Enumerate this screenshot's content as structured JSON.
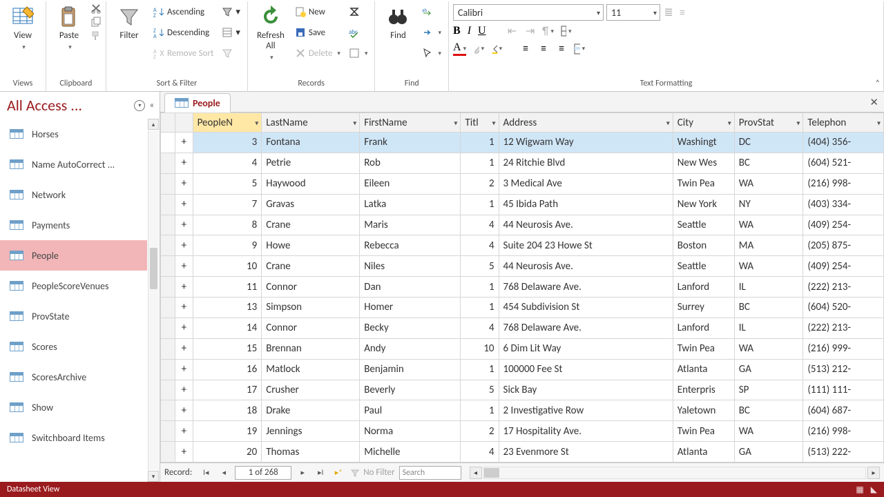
{
  "ribbon": {
    "groups": {
      "views": {
        "label": "Views",
        "view": "View"
      },
      "clipboard": {
        "label": "Clipboard",
        "paste": "Paste"
      },
      "sortfilter": {
        "label": "Sort & Filter",
        "filter": "Filter",
        "asc": "Ascending",
        "desc": "Descending",
        "remove": "Remove Sort"
      },
      "records": {
        "label": "Records",
        "refresh": "Refresh All",
        "new": "New",
        "save": "Save",
        "delete": "Delete"
      },
      "find": {
        "label": "Find",
        "find": "Find"
      },
      "textfmt": {
        "label": "Text Formatting",
        "font": "Calibri",
        "size": "11"
      }
    }
  },
  "nav": {
    "title": "All Access ...",
    "items": [
      "Horses",
      "Name AutoCorrect ...",
      "Network",
      "Payments",
      "People",
      "PeopleScoreVenues",
      "ProvState",
      "Scores",
      "ScoresArchive",
      "Show",
      "Switchboard Items"
    ],
    "selected": 4
  },
  "tab": {
    "title": "People"
  },
  "columns": [
    "PeopleN",
    "LastName",
    "FirstName",
    "Titl",
    "Address",
    "City",
    "ProvStat",
    "Telephon"
  ],
  "rows": [
    {
      "id": "3",
      "last": "Fontana",
      "first": "Frank",
      "title": "1",
      "addr": "12 Wigwam Way",
      "city": "Washingt",
      "prov": "DC",
      "tel": "(404) 356-"
    },
    {
      "id": "4",
      "last": "Petrie",
      "first": "Rob",
      "title": "1",
      "addr": "24 Ritchie Blvd",
      "city": "New Wes",
      "prov": "BC",
      "tel": "(604) 521-"
    },
    {
      "id": "5",
      "last": "Haywood",
      "first": "Eileen",
      "title": "2",
      "addr": "3 Medical Ave",
      "city": "Twin Pea",
      "prov": "WA",
      "tel": "(216) 998-"
    },
    {
      "id": "7",
      "last": "Gravas",
      "first": "Latka",
      "title": "1",
      "addr": "45 Ibida Path",
      "city": "New York",
      "prov": "NY",
      "tel": "(403) 334-"
    },
    {
      "id": "8",
      "last": "Crane",
      "first": "Maris",
      "title": "4",
      "addr": "44 Neurosis Ave.",
      "city": "Seattle",
      "prov": "WA",
      "tel": "(409) 254-"
    },
    {
      "id": "9",
      "last": "Howe",
      "first": "Rebecca",
      "title": "4",
      "addr": "Suite 204 23 Howe St",
      "city": "Boston",
      "prov": "MA",
      "tel": "(205) 875-"
    },
    {
      "id": "10",
      "last": "Crane",
      "first": "Niles",
      "title": "5",
      "addr": "44 Neurosis Ave.",
      "city": "Seattle",
      "prov": "WA",
      "tel": "(409) 254-"
    },
    {
      "id": "11",
      "last": "Connor",
      "first": "Dan",
      "title": "1",
      "addr": "768 Delaware Ave.",
      "city": "Lanford",
      "prov": "IL",
      "tel": "(222) 213-"
    },
    {
      "id": "13",
      "last": "Simpson",
      "first": "Homer",
      "title": "1",
      "addr": "454 Subdivision St",
      "city": "Surrey",
      "prov": "BC",
      "tel": "(604) 520-"
    },
    {
      "id": "14",
      "last": "Connor",
      "first": "Becky",
      "title": "4",
      "addr": "768 Delaware Ave.",
      "city": "Lanford",
      "prov": "IL",
      "tel": "(222) 213-"
    },
    {
      "id": "15",
      "last": "Brennan",
      "first": "Andy",
      "title": "10",
      "addr": "6 Dim Lit Way",
      "city": "Twin Pea",
      "prov": "WA",
      "tel": "(216) 999-"
    },
    {
      "id": "16",
      "last": "Matlock",
      "first": "Benjamin",
      "title": "1",
      "addr": "100000 Fee St",
      "city": "Atlanta",
      "prov": "GA",
      "tel": "(513) 212-"
    },
    {
      "id": "17",
      "last": "Crusher",
      "first": "Beverly",
      "title": "5",
      "addr": "Sick Bay",
      "city": "Enterpris",
      "prov": "SP",
      "tel": "(111) 111-"
    },
    {
      "id": "18",
      "last": "Drake",
      "first": "Paul",
      "title": "1",
      "addr": "2 Investigative Row",
      "city": "Yaletown",
      "prov": "BC",
      "tel": "(604) 687-"
    },
    {
      "id": "19",
      "last": "Jennings",
      "first": "Norma",
      "title": "2",
      "addr": "17 Hospitality Ave.",
      "city": "Twin Pea",
      "prov": "WA",
      "tel": "(216) 998-"
    },
    {
      "id": "20",
      "last": "Thomas",
      "first": "Michelle",
      "title": "4",
      "addr": "23 Evenmore St",
      "city": "Atlanta",
      "prov": "GA",
      "tel": "(513) 222-"
    }
  ],
  "recordnav": {
    "label": "Record:",
    "pos": "1 of 268",
    "nofilter": "No Filter",
    "search": "Search"
  },
  "status": {
    "view": "Datasheet View"
  }
}
